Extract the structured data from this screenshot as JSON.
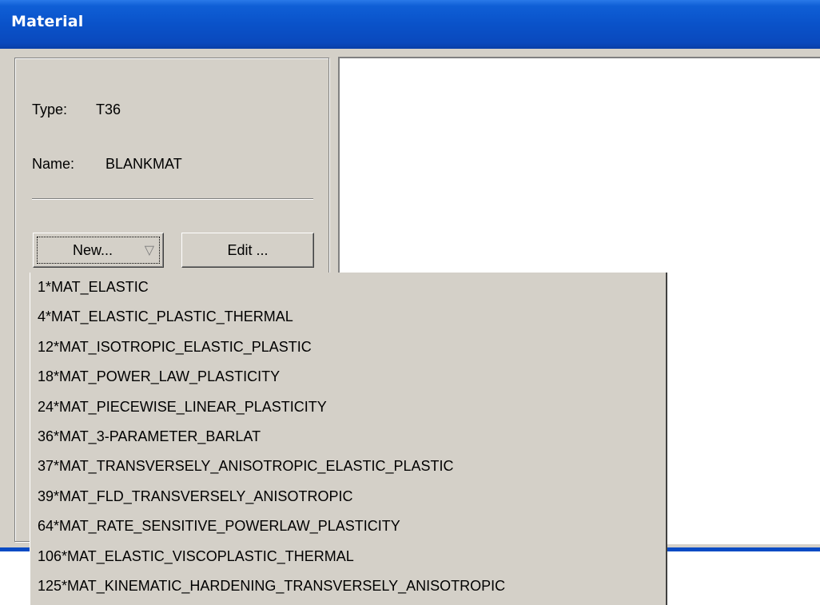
{
  "window": {
    "title": "Material"
  },
  "info": {
    "type_label": "Type:",
    "type_value": "T36",
    "name_label": "Name:",
    "name_value": "BLANKMAT"
  },
  "buttons": {
    "new_label": "New...",
    "new_arrow": "▽",
    "edit_label": "Edit ..."
  },
  "dropdown": {
    "items": [
      "1*MAT_ELASTIC",
      "4*MAT_ELASTIC_PLASTIC_THERMAL",
      "12*MAT_ISOTROPIC_ELASTIC_PLASTIC",
      "18*MAT_POWER_LAW_PLASTICITY",
      "24*MAT_PIECEWISE_LINEAR_PLASTICITY",
      "36*MAT_3-PARAMETER_BARLAT",
      "37*MAT_TRANSVERSELY_ANISOTROPIC_ELASTIC_PLASTIC",
      "39*MAT_FLD_TRANSVERSELY_ANISOTROPIC",
      "64*MAT_RATE_SENSITIVE_POWERLAW_PLASTICITY",
      "106*MAT_ELASTIC_VISCOPLASTIC_THERMAL",
      "125*MAT_KINEMATIC_HARDENING_TRANSVERSELY_ANISOTROPIC"
    ]
  },
  "colors": {
    "titlebar": "#0a52c9",
    "face": "#d4d0c8",
    "pane": "#ffffff"
  }
}
